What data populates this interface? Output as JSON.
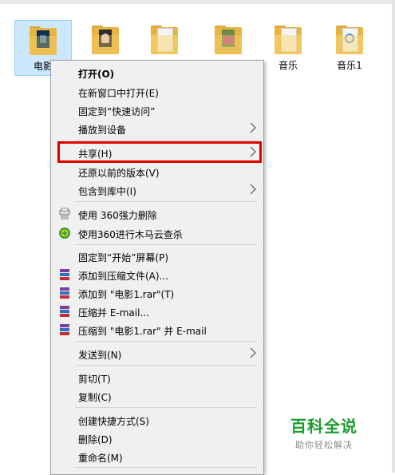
{
  "desktop": {
    "icons": [
      {
        "label": "电影",
        "selected": true
      },
      {
        "label": ""
      },
      {
        "label": ""
      },
      {
        "label": ""
      },
      {
        "label": "音乐"
      },
      {
        "label": "音乐1"
      }
    ]
  },
  "context_menu": {
    "items": [
      {
        "label": "打开(O)",
        "bold": true
      },
      {
        "label": "在新窗口中打开(E)"
      },
      {
        "label": "固定到“快速访问”"
      },
      {
        "label": "播放到设备",
        "submenu": true
      },
      {
        "label": "共享(H)",
        "submenu": true,
        "highlighted": true
      },
      {
        "label": "还原以前的版本(V)"
      },
      {
        "label": "包含到库中(I)",
        "submenu": true
      },
      {
        "label": "使用 360强力删除",
        "icon": "360-shredder-icon"
      },
      {
        "label": "使用360进行木马云查杀",
        "icon": "360-scan-icon"
      },
      {
        "label": "固定到“开始”屏幕(P)"
      },
      {
        "label": "添加到压缩文件(A)...",
        "icon": "winrar-icon"
      },
      {
        "label": "添加到 \"电影1.rar\"(T)",
        "icon": "winrar-icon"
      },
      {
        "label": "压缩并 E-mail...",
        "icon": "winrar-icon"
      },
      {
        "label": "压缩到 \"电影1.rar\" 并 E-mail",
        "icon": "winrar-icon"
      },
      {
        "label": "发送到(N)",
        "submenu": true
      },
      {
        "label": "剪切(T)"
      },
      {
        "label": "复制(C)"
      },
      {
        "label": "创建快捷方式(S)"
      },
      {
        "label": "删除(D)"
      },
      {
        "label": "重命名(M)"
      }
    ]
  },
  "watermark": {
    "title": "百科全说",
    "subtitle": "助你轻松解决"
  },
  "colors": {
    "highlight_border": "#e00000",
    "selection_bg": "#cce8ff",
    "watermark_green": "#1a9d2c"
  }
}
